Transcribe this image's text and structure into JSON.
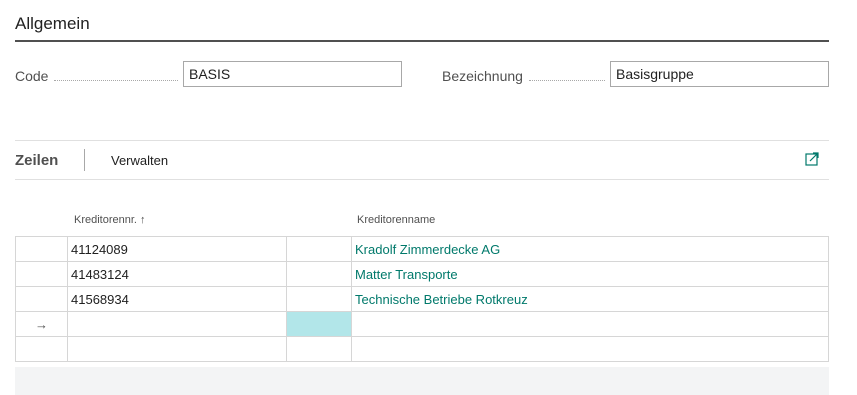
{
  "general": {
    "section_title": "Allgemein",
    "code_label": "Code",
    "code_value": "BASIS",
    "description_label": "Bezeichnung",
    "description_value": "Basisgruppe"
  },
  "lines": {
    "tab_title": "Zeilen",
    "manage_action": "Verwalten",
    "expand_icon": "open-in-new-window-icon"
  },
  "table": {
    "columns": [
      "Kreditorennr.",
      "Kreditorenname"
    ],
    "sort_indicator": "↑",
    "rows": [
      {
        "marker": "",
        "vendor_no": "41124089",
        "vendor_name": "Kradolf Zimmerdecke AG"
      },
      {
        "marker": "",
        "vendor_no": "41483124",
        "vendor_name": "Matter Transporte"
      },
      {
        "marker": "",
        "vendor_no": "41568934",
        "vendor_name": "Technische Betriebe Rotkreuz"
      },
      {
        "marker": "→",
        "vendor_no": "",
        "vendor_name": ""
      },
      {
        "marker": "",
        "vendor_no": "",
        "vendor_name": ""
      }
    ]
  },
  "colors": {
    "link": "#00796b",
    "focus_cell": "#b2e6e9",
    "section_rule": "#505050"
  }
}
